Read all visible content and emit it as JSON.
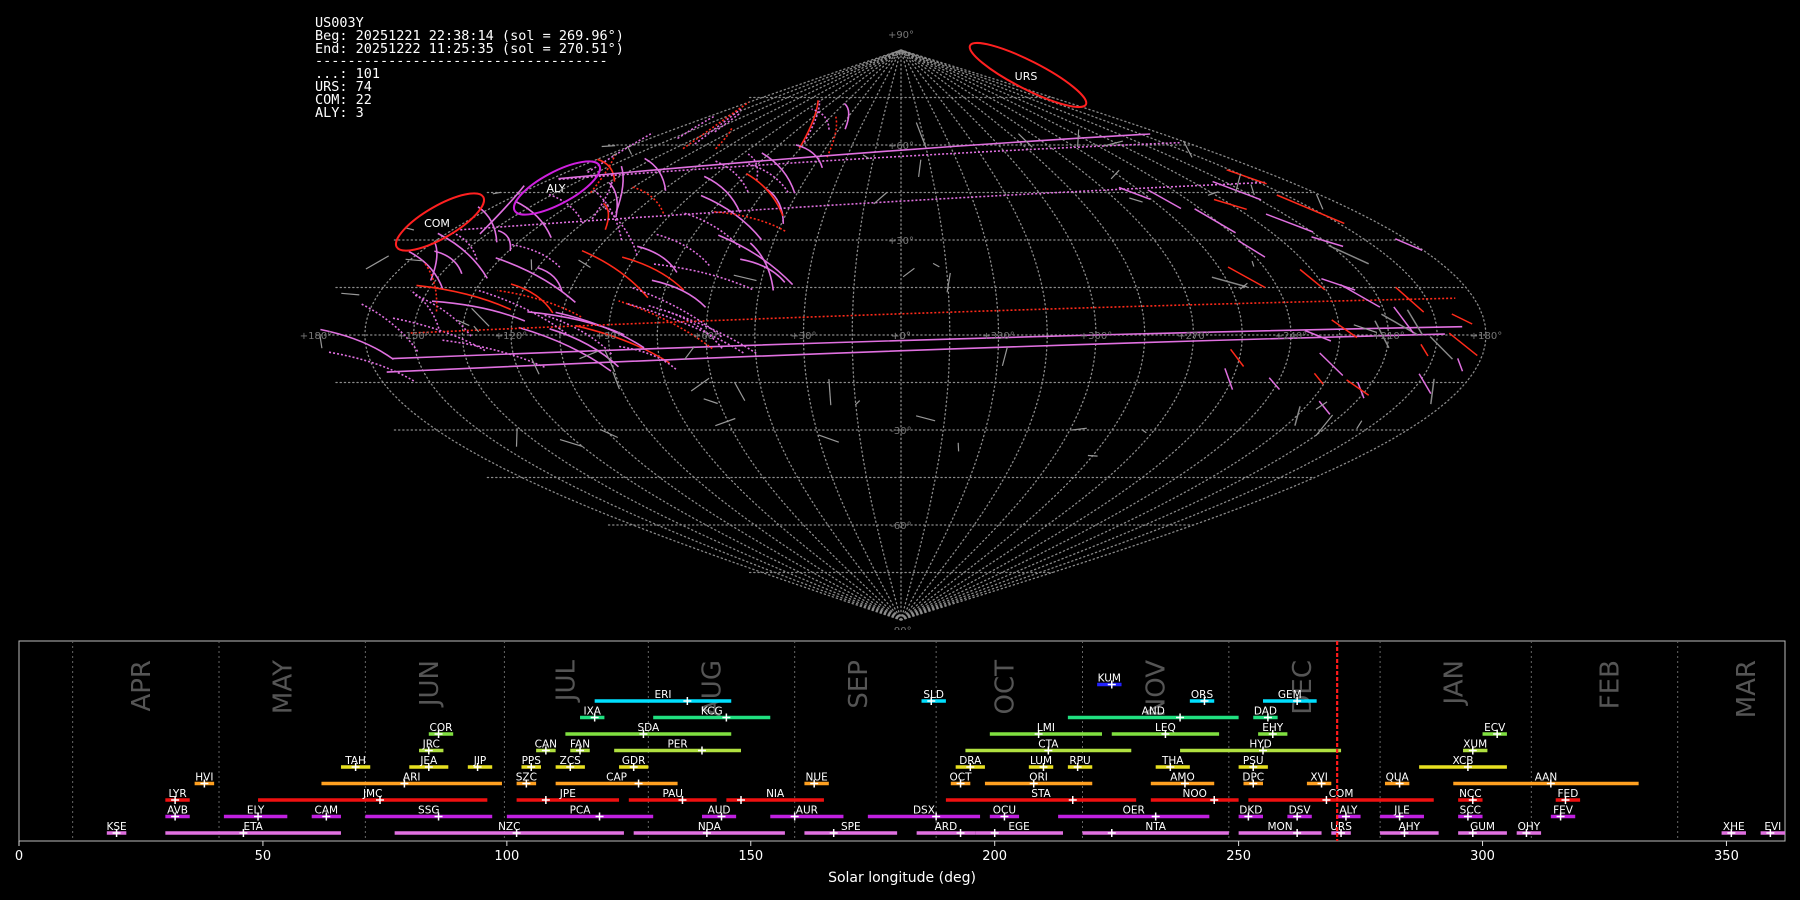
{
  "info": {
    "station": "US003Y",
    "beg": "Beg: 20251221 22:38:14 (sol = 269.96°)",
    "end": "End: 20251222 11:25:35 (sol = 270.51°)",
    "rule": "------------------------------------",
    "counts": [
      "...: 101",
      "URS: 74",
      "COM: 22",
      "ALY: 3"
    ]
  },
  "sky": {
    "lat_labels": [
      "+90°",
      "+60°",
      "+30°",
      "+0°",
      "-30°",
      "-60°",
      "-90°"
    ],
    "lon_labels": [
      "+180°",
      "+150°",
      "+120°",
      "+90°",
      "+60°",
      "+30°",
      "+0°",
      "+330°",
      "+300°",
      "+270°",
      "+240°",
      "+210°",
      "+180°"
    ],
    "radiants": [
      {
        "code": "URS",
        "color": "#ff2020"
      },
      {
        "code": "ALY",
        "color": "#d020e0"
      },
      {
        "code": "COM",
        "color": "#ff2020"
      }
    ]
  },
  "chart_data": {
    "type": "timeline",
    "xlabel": "Solar longitude (deg)",
    "xlim": [
      0,
      362
    ],
    "xticks": [
      0,
      50,
      100,
      150,
      200,
      250,
      300,
      350
    ],
    "current_sol": 270.2,
    "month_boundaries": [
      11,
      41,
      71,
      99.5,
      129,
      159,
      188,
      218,
      248,
      279,
      310,
      340
    ],
    "months": [
      {
        "label": "APR",
        "sol": 25
      },
      {
        "label": "MAY",
        "sol": 54
      },
      {
        "label": "JUN",
        "sol": 84
      },
      {
        "label": "JUL",
        "sol": 112
      },
      {
        "label": "AUG",
        "sol": 142
      },
      {
        "label": "SEP",
        "sol": 172
      },
      {
        "label": "OCT",
        "sol": 202
      },
      {
        "label": "NOV",
        "sol": 233
      },
      {
        "label": "DEC",
        "sol": 263
      },
      {
        "label": "JAN",
        "sol": 294
      },
      {
        "label": "FEB",
        "sol": 326
      },
      {
        "label": "MAR",
        "sol": 354
      }
    ],
    "showers": [
      {
        "code": "KUM",
        "start": 221,
        "end": 226,
        "peak": 224,
        "row": 9,
        "color": "#2222ff"
      },
      {
        "code": "ERI",
        "start": 118,
        "end": 146,
        "peak": 137,
        "row": 8,
        "color": "#00e0ff"
      },
      {
        "code": "SLD",
        "start": 185,
        "end": 190,
        "peak": 187,
        "row": 8,
        "color": "#00e0ff"
      },
      {
        "code": "ORS",
        "start": 240,
        "end": 245,
        "peak": 243,
        "row": 8,
        "color": "#00e0ff"
      },
      {
        "code": "GEM",
        "start": 255,
        "end": 266,
        "peak": 262,
        "row": 8,
        "color": "#00e0ff"
      },
      {
        "code": "IXA",
        "start": 115,
        "end": 120,
        "peak": 118,
        "row": 7,
        "color": "#20e080"
      },
      {
        "code": "KCG",
        "start": 130,
        "end": 154,
        "peak": 145,
        "row": 7,
        "color": "#20e080"
      },
      {
        "code": "AND",
        "start": 215,
        "end": 250,
        "peak": 238,
        "row": 7,
        "color": "#20e080"
      },
      {
        "code": "DAD",
        "start": 253,
        "end": 258,
        "peak": 256,
        "row": 7,
        "color": "#20e080"
      },
      {
        "code": "COR",
        "start": 84,
        "end": 89,
        "peak": 86,
        "row": 6,
        "color": "#80e040"
      },
      {
        "code": "SDA",
        "start": 112,
        "end": 146,
        "peak": 128,
        "row": 6,
        "color": "#80e040"
      },
      {
        "code": "LMI",
        "start": 199,
        "end": 222,
        "peak": 209,
        "row": 6,
        "color": "#80e040"
      },
      {
        "code": "LEQ",
        "start": 224,
        "end": 246,
        "peak": 235,
        "row": 6,
        "color": "#80e040"
      },
      {
        "code": "EHY",
        "start": 254,
        "end": 260,
        "peak": 257,
        "row": 6,
        "color": "#80e040"
      },
      {
        "code": "ECV",
        "start": 300,
        "end": 305,
        "peak": 303,
        "row": 6,
        "color": "#80e040"
      },
      {
        "code": "JRC",
        "start": 82,
        "end": 87,
        "peak": 84,
        "row": 5,
        "color": "#b0e040"
      },
      {
        "code": "CAN",
        "start": 106,
        "end": 110,
        "peak": 108,
        "row": 5,
        "color": "#b0e040"
      },
      {
        "code": "FAN",
        "start": 113,
        "end": 117,
        "peak": 115,
        "row": 5,
        "color": "#b0e040"
      },
      {
        "code": "PER",
        "start": 122,
        "end": 148,
        "peak": 140,
        "row": 5,
        "color": "#b0e040"
      },
      {
        "code": "CTA",
        "start": 194,
        "end": 228,
        "peak": 211,
        "row": 5,
        "color": "#b0e040"
      },
      {
        "code": "HYD",
        "start": 238,
        "end": 271,
        "peak": 255,
        "row": 5,
        "color": "#b0e040"
      },
      {
        "code": "XUM",
        "start": 296,
        "end": 301,
        "peak": 298,
        "row": 5,
        "color": "#b0e040"
      },
      {
        "code": "TAH",
        "start": 66,
        "end": 72,
        "peak": 69,
        "row": 4,
        "color": "#e8e020"
      },
      {
        "code": "JEA",
        "start": 80,
        "end": 88,
        "peak": 84,
        "row": 4,
        "color": "#e8e020"
      },
      {
        "code": "JIP",
        "start": 92,
        "end": 97,
        "peak": 94,
        "row": 4,
        "color": "#e8e020"
      },
      {
        "code": "PPS",
        "start": 103,
        "end": 107,
        "peak": 105,
        "row": 4,
        "color": "#e8e020"
      },
      {
        "code": "ZCS",
        "start": 110,
        "end": 116,
        "peak": 113,
        "row": 4,
        "color": "#e8e020"
      },
      {
        "code": "GDR",
        "start": 123,
        "end": 129,
        "peak": 126,
        "row": 4,
        "color": "#e8e020"
      },
      {
        "code": "DRA",
        "start": 192,
        "end": 198,
        "peak": 195,
        "row": 4,
        "color": "#e8e020"
      },
      {
        "code": "LUM",
        "start": 207,
        "end": 212,
        "peak": 210,
        "row": 4,
        "color": "#e8e020"
      },
      {
        "code": "RPU",
        "start": 215,
        "end": 220,
        "peak": 217,
        "row": 4,
        "color": "#e8e020"
      },
      {
        "code": "THA",
        "start": 233,
        "end": 240,
        "peak": 236,
        "row": 4,
        "color": "#e8e020"
      },
      {
        "code": "PSU",
        "start": 250,
        "end": 256,
        "peak": 253,
        "row": 4,
        "color": "#e8e020"
      },
      {
        "code": "XCB",
        "start": 287,
        "end": 305,
        "peak": 297,
        "row": 4,
        "color": "#e8e020"
      },
      {
        "code": "HVI",
        "start": 36,
        "end": 40,
        "peak": 38,
        "row": 3,
        "color": "#ffa020"
      },
      {
        "code": "ARI",
        "start": 62,
        "end": 99,
        "peak": 79,
        "row": 3,
        "color": "#ffa020"
      },
      {
        "code": "SZC",
        "start": 102,
        "end": 106,
        "peak": 104,
        "row": 3,
        "color": "#ffa020"
      },
      {
        "code": "CAP",
        "start": 110,
        "end": 135,
        "peak": 127,
        "row": 3,
        "color": "#ffa020"
      },
      {
        "code": "NUE",
        "start": 161,
        "end": 166,
        "peak": 163,
        "row": 3,
        "color": "#ffa020"
      },
      {
        "code": "OCT",
        "start": 191,
        "end": 195,
        "peak": 193,
        "row": 3,
        "color": "#ffa020"
      },
      {
        "code": "ORI",
        "start": 198,
        "end": 220,
        "peak": 208,
        "row": 3,
        "color": "#ffa020"
      },
      {
        "code": "AMO",
        "start": 232,
        "end": 245,
        "peak": 239,
        "row": 3,
        "color": "#ffa020"
      },
      {
        "code": "DPC",
        "start": 251,
        "end": 255,
        "peak": 253,
        "row": 3,
        "color": "#ffa020"
      },
      {
        "code": "XVI",
        "start": 264,
        "end": 269,
        "peak": 267,
        "row": 3,
        "color": "#ffa020"
      },
      {
        "code": "QUA",
        "start": 280,
        "end": 285,
        "peak": 283,
        "row": 3,
        "color": "#ffa020"
      },
      {
        "code": "AAN",
        "start": 294,
        "end": 332,
        "peak": 314,
        "row": 3,
        "color": "#ffa020"
      },
      {
        "code": "LYR",
        "start": 30,
        "end": 35,
        "peak": 32,
        "row": 2,
        "color": "#f01010"
      },
      {
        "code": "JMC",
        "start": 49,
        "end": 96,
        "peak": 74,
        "row": 2,
        "color": "#f01010"
      },
      {
        "code": "JPE",
        "start": 102,
        "end": 123,
        "peak": 108,
        "row": 2,
        "color": "#f01010"
      },
      {
        "code": "PAU",
        "start": 125,
        "end": 143,
        "peak": 136,
        "row": 2,
        "color": "#f01010"
      },
      {
        "code": "NIA",
        "start": 145,
        "end": 165,
        "peak": 148,
        "row": 2,
        "color": "#f01010"
      },
      {
        "code": "STA",
        "start": 190,
        "end": 229,
        "peak": 216,
        "row": 2,
        "color": "#f01010"
      },
      {
        "code": "NOO",
        "start": 232,
        "end": 250,
        "peak": 245,
        "row": 2,
        "color": "#f01010"
      },
      {
        "code": "COM",
        "start": 252,
        "end": 290,
        "peak": 268,
        "row": 2,
        "color": "#f01010"
      },
      {
        "code": "NCC",
        "start": 295,
        "end": 300,
        "peak": 298,
        "row": 2,
        "color": "#f01010"
      },
      {
        "code": "FED",
        "start": 315,
        "end": 320,
        "peak": 317,
        "row": 2,
        "color": "#f01010"
      },
      {
        "code": "AVB",
        "start": 30,
        "end": 35,
        "peak": 32,
        "row": 1,
        "color": "#c020e0"
      },
      {
        "code": "ELY",
        "start": 42,
        "end": 55,
        "peak": 49,
        "row": 1,
        "color": "#c020e0"
      },
      {
        "code": "CAM",
        "start": 60,
        "end": 66,
        "peak": 63,
        "row": 1,
        "color": "#c020e0"
      },
      {
        "code": "SSG",
        "start": 71,
        "end": 97,
        "peak": 86,
        "row": 1,
        "color": "#c020e0"
      },
      {
        "code": "PCA",
        "start": 100,
        "end": 130,
        "peak": 119,
        "row": 1,
        "color": "#c020e0"
      },
      {
        "code": "AUD",
        "start": 140,
        "end": 147,
        "peak": 144,
        "row": 1,
        "color": "#c020e0"
      },
      {
        "code": "AUR",
        "start": 154,
        "end": 169,
        "peak": 159,
        "row": 1,
        "color": "#c020e0"
      },
      {
        "code": "DSX",
        "start": 174,
        "end": 197,
        "peak": 188,
        "row": 1,
        "color": "#c020e0"
      },
      {
        "code": "OCU",
        "start": 199,
        "end": 205,
        "peak": 202,
        "row": 1,
        "color": "#c020e0"
      },
      {
        "code": "OER",
        "start": 213,
        "end": 244,
        "peak": 233,
        "row": 1,
        "color": "#c020e0"
      },
      {
        "code": "DKD",
        "start": 250,
        "end": 255,
        "peak": 252,
        "row": 1,
        "color": "#c020e0"
      },
      {
        "code": "DSV",
        "start": 260,
        "end": 265,
        "peak": 262,
        "row": 1,
        "color": "#c020e0"
      },
      {
        "code": "ALY",
        "start": 270,
        "end": 275,
        "peak": 272,
        "row": 1,
        "color": "#c020e0"
      },
      {
        "code": "JLE",
        "start": 279,
        "end": 288,
        "peak": 283,
        "row": 1,
        "color": "#c020e0"
      },
      {
        "code": "SCC",
        "start": 295,
        "end": 300,
        "peak": 297,
        "row": 1,
        "color": "#c020e0"
      },
      {
        "code": "FEV",
        "start": 314,
        "end": 319,
        "peak": 316,
        "row": 1,
        "color": "#c020e0"
      },
      {
        "code": "KSE",
        "start": 18,
        "end": 22,
        "peak": 20,
        "row": 0,
        "color": "#e070e0"
      },
      {
        "code": "ETA",
        "start": 30,
        "end": 66,
        "peak": 46,
        "row": 0,
        "color": "#e070e0"
      },
      {
        "code": "NZC",
        "start": 77,
        "end": 124,
        "peak": 102,
        "row": 0,
        "color": "#e070e0"
      },
      {
        "code": "NDA",
        "start": 126,
        "end": 157,
        "peak": 141,
        "row": 0,
        "color": "#e070e0"
      },
      {
        "code": "SPE",
        "start": 161,
        "end": 180,
        "peak": 167,
        "row": 0,
        "color": "#e070e0"
      },
      {
        "code": "ARD",
        "start": 184,
        "end": 196,
        "peak": 193,
        "row": 0,
        "color": "#e070e0"
      },
      {
        "code": "EGE",
        "start": 196,
        "end": 214,
        "peak": 200,
        "row": 0,
        "color": "#e070e0"
      },
      {
        "code": "NTA",
        "start": 218,
        "end": 248,
        "peak": 224,
        "row": 0,
        "color": "#e070e0"
      },
      {
        "code": "MON",
        "start": 250,
        "end": 267,
        "peak": 262,
        "row": 0,
        "color": "#e070e0"
      },
      {
        "code": "URS",
        "start": 269,
        "end": 273,
        "peak": 271,
        "row": 0,
        "color": "#e070e0"
      },
      {
        "code": "AHY",
        "start": 279,
        "end": 291,
        "peak": 284,
        "row": 0,
        "color": "#e070e0"
      },
      {
        "code": "GUM",
        "start": 295,
        "end": 305,
        "peak": 298,
        "row": 0,
        "color": "#e070e0"
      },
      {
        "code": "OHY",
        "start": 307,
        "end": 312,
        "peak": 309,
        "row": 0,
        "color": "#e070e0"
      },
      {
        "code": "XHE",
        "start": 349,
        "end": 354,
        "peak": 351,
        "row": 0,
        "color": "#e070e0"
      },
      {
        "code": "EVI",
        "start": 357,
        "end": 362,
        "peak": 359,
        "row": 0,
        "color": "#e070e0"
      }
    ]
  }
}
